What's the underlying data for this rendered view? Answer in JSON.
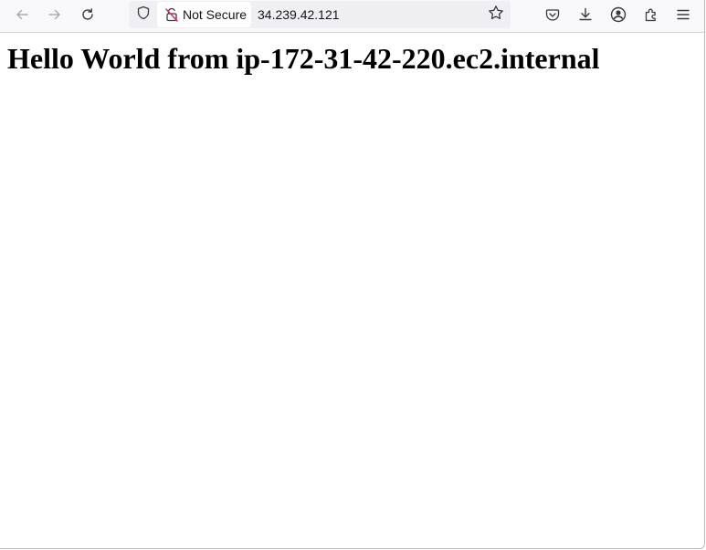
{
  "toolbar": {
    "icons": {
      "back": "arrow-left-icon",
      "forward": "arrow-right-icon",
      "reload": "reload-icon",
      "tracking_protection": "shield-icon",
      "insecure": "broken-lock-icon",
      "bookmark": "star-icon",
      "pocket": "pocket-icon",
      "downloads": "download-icon",
      "account": "account-icon",
      "extensions": "puzzle-icon",
      "menu": "hamburger-menu-icon"
    },
    "insecure_color": "#e22850"
  },
  "urlbar": {
    "security_label": "Not Secure",
    "url": "34.239.42.121"
  },
  "page": {
    "heading": "Hello World from ip-172-31-42-220.ec2.internal"
  }
}
